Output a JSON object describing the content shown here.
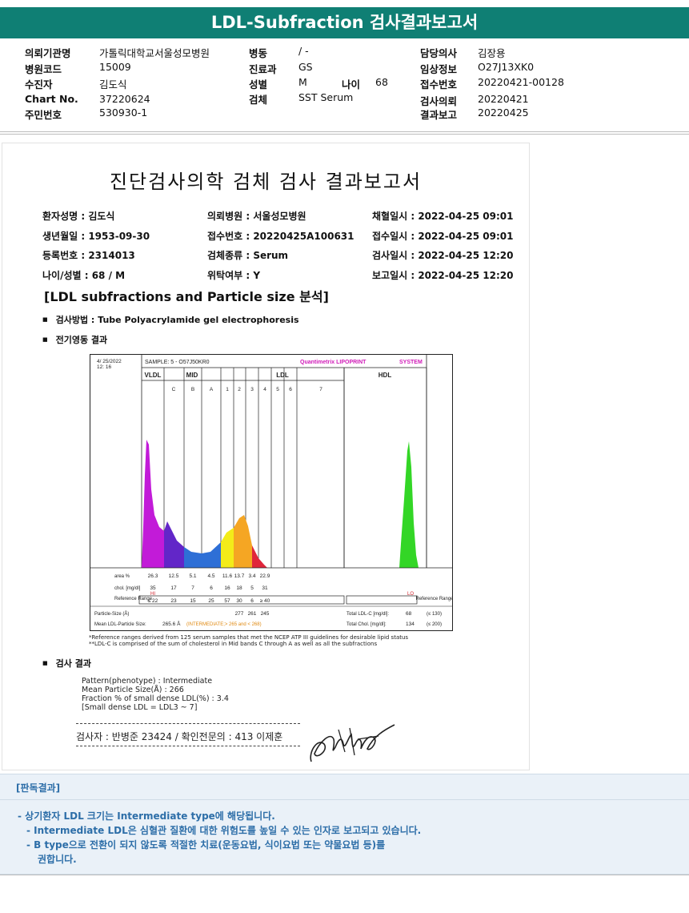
{
  "header": {
    "title": "LDL-Subfraction 검사결과보고서"
  },
  "meta": {
    "col1": [
      {
        "label": "의뢰기관명",
        "value": "가톨릭대학교서울성모병원"
      },
      {
        "label": "병원코드",
        "value": "15009"
      },
      {
        "label": "수진자",
        "value": "김도식"
      },
      {
        "label": "Chart No.",
        "value": "37220624"
      },
      {
        "label": "주민번호",
        "value": "530930-1"
      }
    ],
    "col2": [
      {
        "label": "병동",
        "value": "/ -"
      },
      {
        "label": "진료과",
        "value": "GS"
      },
      {
        "label": "성별",
        "value": "M"
      },
      {
        "label": "검체",
        "value": "SST Serum"
      }
    ],
    "age": {
      "label": "나이",
      "value": "68"
    },
    "col3": [
      {
        "label": "담당의사",
        "value": "김장용"
      },
      {
        "label": "임상정보",
        "value": "O27J13XK0"
      },
      {
        "label": "접수번호",
        "value": "20220421-00128"
      },
      {
        "label": "검사의뢰",
        "value": "20220421"
      },
      {
        "label": "결과보고",
        "value": "20220425"
      }
    ]
  },
  "report": {
    "title": "진단검사의학 검체 검사 결과보고서",
    "patient": [
      [
        "환자성명 : 김도식",
        "의뢰병원 : 서울성모병원",
        "채혈일시 : 2022-04-25 09:01"
      ],
      [
        "생년월일 : 1953-09-30",
        "접수번호 : 20220425A100631",
        "접수일시 : 2022-04-25 09:01"
      ],
      [
        "등록번호 : 2314013",
        "검체종류 : Serum",
        "검사일시 : 2022-04-25 12:20"
      ],
      [
        "나이/성별 : 68 / M",
        "위탁여부 : Y",
        "보고일시 : 2022-04-25 12:20"
      ]
    ],
    "section_title": "[LDL subfractions and Particle size 분석]",
    "method": "검사방법 : Tube Polyacrylamide gel electrophoresis",
    "electro": "전기영동 결과",
    "result_title": "검사 결과",
    "results": [
      "Pattern(phenotype) : Intermediate",
      "Mean Particle Size(Å) : 266",
      "Fraction % of small dense LDL(%) : 3.4",
      "[Small dense LDL = LDL3 ~ 7]"
    ],
    "signature": "검사자 : 반병준  23424  /  확인전문의 : 413  이제훈",
    "notes": [
      "*Reference ranges derived from 125 serum samples that met the NCEP ATP III guidelines for desirable lipid status",
      "**LDL-C is comprised of the sum of cholesterol in Mid bands C through A as well as all the subfractions"
    ]
  },
  "chart_data": {
    "type": "area",
    "date": "4/ 25/2022",
    "time": "12: 16",
    "sample": "SAMPLE:   5 - O57J50KR0",
    "brand": "Quantimetrix LIPOPRINT",
    "brand_suffix": "SYSTEM",
    "groups": [
      "VLDL",
      "MID",
      "LDL",
      "HDL"
    ],
    "bands": [
      "C",
      "B",
      "A",
      "1",
      "2",
      "3",
      "4",
      "5",
      "6",
      "7"
    ],
    "row_labels": {
      "area": "area %",
      "chol": "chol. [mg/dl]",
      "ref": "Reference Range"
    },
    "fractions": [
      "VLDL",
      "C",
      "B",
      "A",
      "1",
      "2",
      "3",
      "HDL"
    ],
    "area_pct": [
      26.3,
      12.5,
      5.1,
      4.5,
      11.6,
      13.7,
      3.4,
      22.9
    ],
    "chol_mgdl": [
      35,
      17,
      7,
      6,
      16,
      18,
      5,
      31
    ],
    "chol_flags": {
      "VLDL": "HI",
      "HDL": "LO"
    },
    "reference": [
      "≤ 22",
      "23",
      "15",
      "25",
      "57",
      "30",
      "6",
      "≥ 40"
    ],
    "reference_label_right": "Reference Range",
    "particle_size_label": "Particle-Size (Å)",
    "particle_size": [
      "277",
      "261",
      "245"
    ],
    "mean_ldl_label": "Mean LDL-Particle Size:",
    "mean_ldl": "265.6 Å",
    "mean_ldl_class": "INTERMEDIATE",
    "mean_ldl_ref": "(INTERMEDIATE;> 265 and < 268)",
    "total_ldl_label": "Total LDL-C [mg/dl]:",
    "total_ldl": "68",
    "total_ldl_ref": "(≤ 130)",
    "total_chol_label": "Total Chol. [mg/dl]:",
    "total_chol": "134",
    "total_chol_ref": "(≤ 200)",
    "colors": {
      "vldl": "#c21bd8",
      "mid": "#6226c8",
      "midA": "#2e6fd6",
      "ldl1": "#f3ec19",
      "ldl2": "#f5a623",
      "ldl3": "#e0253b",
      "hdl": "#33d626"
    }
  },
  "judgement": {
    "title": "[판독결과]",
    "lines": [
      "-  상기환자 LDL 크기는 Intermediate type에 해당됩니다.",
      "-  Intermediate LDL은 심혈관 질환에 대한 위험도를 높일 수 있는 인자로 보고되고 있습니다.",
      "-  B type으로 전환이 되지 않도록 적절한 치료(운동요법, 식이요법 또는 약물요법 등)를",
      "권합니다."
    ]
  }
}
